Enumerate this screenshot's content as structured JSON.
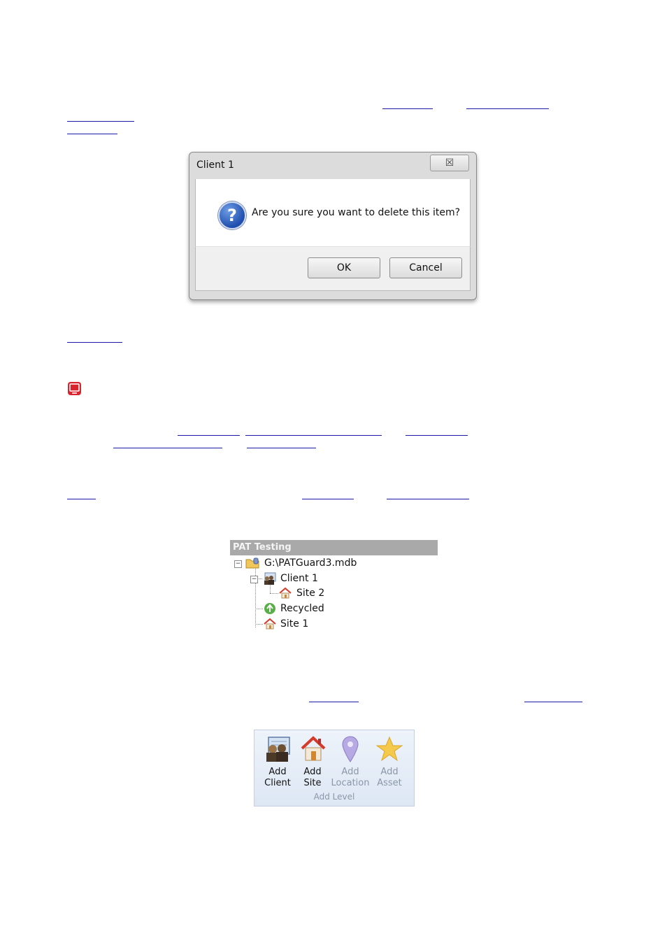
{
  "dialog": {
    "title": "Client 1",
    "close_symbol": "☒",
    "message": "Are you sure you want to delete this item?",
    "ok_label": "OK",
    "cancel_label": "Cancel",
    "icon": "question-icon"
  },
  "tree": {
    "header": "PAT Testing",
    "items": [
      {
        "label": "G:\\PATGuard3.mdb",
        "icon": "database-folder-icon"
      },
      {
        "label": "Client 1",
        "icon": "client-icon"
      },
      {
        "label": "Site 2",
        "icon": "site-icon"
      },
      {
        "label": "Recycled",
        "icon": "recycle-icon"
      },
      {
        "label": "Site 1",
        "icon": "site-icon"
      }
    ]
  },
  "ribbon": {
    "buttons": [
      {
        "line1": "Add",
        "line2": "Client",
        "icon": "client-icon",
        "enabled": true
      },
      {
        "line1": "Add",
        "line2": "Site",
        "icon": "house-icon",
        "enabled": true
      },
      {
        "line1": "Add",
        "line2": "Location",
        "icon": "map-pin-icon",
        "enabled": false
      },
      {
        "line1": "Add",
        "line2": "Asset",
        "icon": "star-icon",
        "enabled": false
      }
    ],
    "group_label": "Add Level"
  },
  "colors": {
    "link": "#1a1aa6",
    "tree_header_bg": "#a9a9a9",
    "disabled_text": "#8a97a8"
  }
}
